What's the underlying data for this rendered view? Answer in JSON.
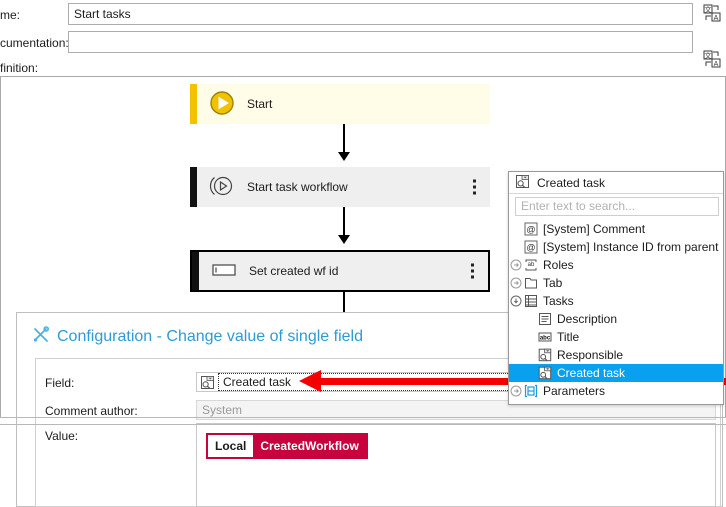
{
  "form": {
    "name_label": "me:",
    "name_value": "Start tasks",
    "documentation_label": "cumentation:",
    "documentation_value": "",
    "definition_label": "finition:",
    "translate_icon": "translate-icon",
    "dropdown_icon": "chevron-down-icon"
  },
  "workflow": {
    "nodes": [
      {
        "id": "start",
        "label": "Start",
        "icon": "play-circle-icon",
        "accent": "#f2c200",
        "fill": "#fffde7",
        "has_menu": false,
        "selected": false
      },
      {
        "id": "start-task-workflow",
        "label": "Start task workflow",
        "icon": "play-circle-outline-icon",
        "accent": "#000000",
        "fill": "#efefef",
        "has_menu": true,
        "selected": false
      },
      {
        "id": "set-created-wf-id",
        "label": "Set created wf id",
        "icon": "text-field-icon",
        "accent": "#000000",
        "fill": "#efefef",
        "has_menu": true,
        "selected": true
      }
    ],
    "menu_icon": "kebab-menu-icon",
    "connector_icon": "arrow-down-icon"
  },
  "configuration": {
    "title": "Configuration - Change value of single field",
    "title_icon": "tools-icon",
    "rows": {
      "field_label": "Field:",
      "field_value": "Created task",
      "field_icon": "lookup-field-icon",
      "comment_author_label": "Comment author:",
      "comment_author_value": "System",
      "value_label": "Value:"
    },
    "token": {
      "scope": "Local",
      "name": "CreatedWorkflow",
      "color": "#c8023c"
    }
  },
  "field_picker": {
    "header_label": "Created task",
    "header_icon": "lookup-field-icon",
    "search_placeholder": "Enter text to search...",
    "items": [
      {
        "label": "[System] Comment",
        "icon": "at-icon",
        "indent": 1,
        "expander": "",
        "selected": false
      },
      {
        "label": "[System] Instance ID from parent",
        "icon": "at-icon",
        "indent": 1,
        "expander": "",
        "selected": false
      },
      {
        "label": "Roles",
        "icon": "string-field-icon",
        "indent": 0,
        "expander": "collapsed",
        "selected": false
      },
      {
        "label": "Tab",
        "icon": "folder-icon",
        "indent": 0,
        "expander": "collapsed",
        "selected": false
      },
      {
        "label": "Tasks",
        "icon": "table-icon",
        "indent": 0,
        "expander": "expanded",
        "selected": false
      },
      {
        "label": "Description",
        "icon": "multiline-text-icon",
        "indent": 2,
        "expander": "",
        "selected": false
      },
      {
        "label": "Title",
        "icon": "abc-icon",
        "indent": 2,
        "expander": "",
        "selected": false
      },
      {
        "label": "Responsible",
        "icon": "lookup-field-icon",
        "indent": 2,
        "expander": "",
        "selected": false
      },
      {
        "label": "Created task",
        "icon": "lookup-field-icon",
        "indent": 2,
        "expander": "",
        "selected": true
      },
      {
        "label": "Parameters",
        "icon": "parameters-icon",
        "indent": 0,
        "expander": "collapsed",
        "selected": false
      }
    ],
    "highlight_color": "#0aa0f0"
  },
  "annotation": {
    "arrow": "red-pointer-arrow",
    "color": "#f40000"
  }
}
